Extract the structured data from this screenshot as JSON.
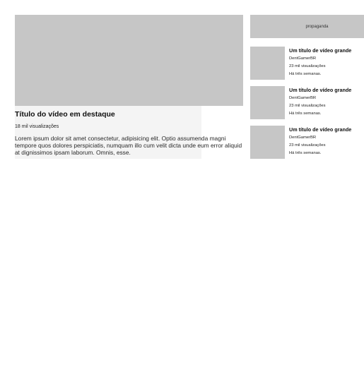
{
  "featured": {
    "title": "Título do vídeo em destaque",
    "views": "18 mil visualizações",
    "description": "Lorem ipsum dolor sit amet consectetur, adipisicing elit. Optio assumenda magni tempore quos dolores perspiciatis, numquam illo cum velit dicta unde eum error aliquid at dignissimos ipsam laborum. Omnis, esse."
  },
  "ad": {
    "label": "propaganda"
  },
  "sidebar": {
    "videos": [
      {
        "title": "Um título de vídeo grande",
        "channel": "DentGamerBR",
        "views": "23 mil visualizações",
        "time": "Há três semanas."
      },
      {
        "title": "Um título de vídeo grande",
        "channel": "DentGamerBR",
        "views": "23 mil visualizações",
        "time": "Há três semanas."
      },
      {
        "title": "Um título de vídeo grande",
        "channel": "DentGamerBR",
        "views": "23 mil visualizações",
        "time": "Há três semanas."
      }
    ]
  }
}
